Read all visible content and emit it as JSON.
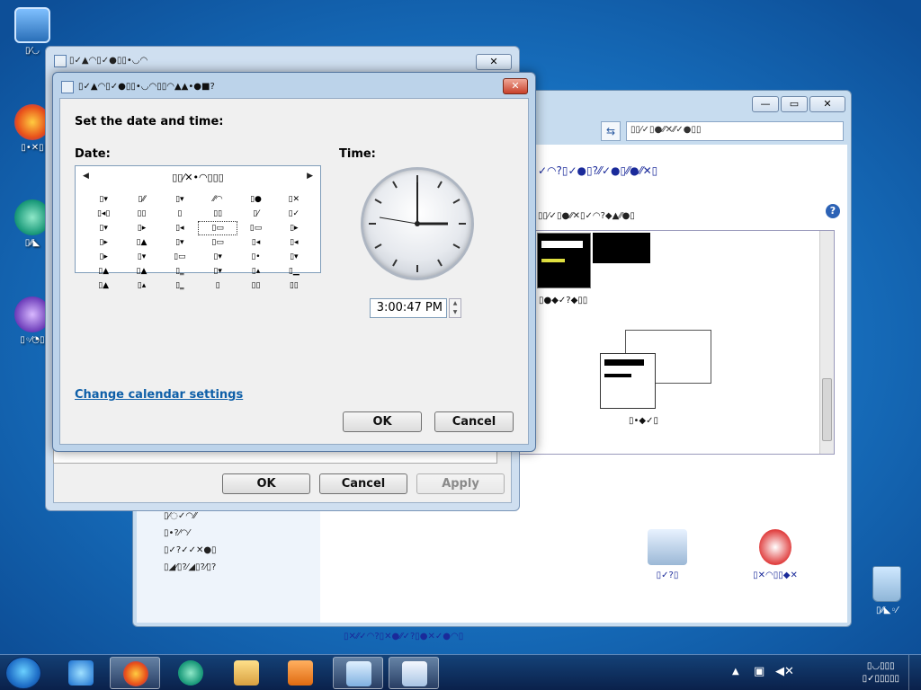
{
  "desktop": {
    "icons": [
      {
        "label": "▯⁄◡"
      },
      {
        "label": "▯•✕▯"
      },
      {
        "label": "▯⁄⁄◣"
      },
      {
        "label": "▯◦⁄◔▯"
      }
    ],
    "recycle_label": "▯⁄⁄◣◦⁄"
  },
  "back_window": {
    "search_placeholder": "▯▯⁄✓▯●⁄⁄✕⁄⁄✓●▯▯",
    "row1": "✓◠?▯✓●▯?⁄⁄✓●▯⁄⁄●⁄⁄✕▯",
    "row2": "▯▯⁄✓▯●⁄⁄✕▯✓◠?◆▲⁄⁄●▯",
    "theme1": "▯⁄◂?▯",
    "theme1b": "▯●◆✓?◆▯▯",
    "theme2": "▯⁄✓?◡",
    "theme2b": "▯•◆✓▯",
    "left_links": [
      "▯⁄◌✓◠⁄⁄",
      "▯•?⁄◠⁄",
      "▯✓?✓✓✕●▯",
      "▯◢⁄▯?⁄◢▯?⁄▯?"
    ],
    "bottom_sound": "▯✓?▯",
    "bottom_screensaver": "▯✕◠▯▯◆✕",
    "footer": "▯✕⁄⁄✓◠?▯✕●⁄⁄✓?▯●✕✓●◠▯"
  },
  "date_time_window": {
    "title": "▯✓▲◠▯✓●▯▯•◡◠",
    "ok_label": "OK",
    "cancel_label": "Cancel",
    "apply_label": "Apply"
  },
  "dialog": {
    "title": "▯✓▲◠▯✓●▯▯•◡◠▯▯◠▲▲•●■?",
    "heading": "Set the date and time:",
    "date_label": "Date:",
    "time_label": "Time:",
    "calendar_month": "▯▯⁄✕•◠▯▯▯",
    "calendar_days": [
      "▯▾",
      "▯⁄⁄",
      "▯▾",
      "⁄⁄◠",
      "▯●",
      "▯✕",
      "▯◂▯",
      "▯▯",
      "▯",
      "▯▯",
      "▯⁄",
      "▯✓",
      "▯▾",
      "▯▸",
      "▯◂",
      "▯▭",
      "▯▭",
      "▯▸",
      "▯▸",
      "▯▲",
      "▯▾",
      "▯▭",
      "▯◂",
      "▯◂",
      "▯▸",
      "▯▾",
      "▯▭",
      "▯▾",
      "▯•",
      "▯▾",
      "▯▲",
      "▯▲",
      "▯‗",
      "▯▾",
      "▯▴",
      "▯▁",
      "▯▲",
      "▯▴",
      "▯‗",
      "▯",
      "▯▯",
      "▯▯"
    ],
    "time_value": "3:00:47 PM",
    "calendar_link": "Change calendar settings",
    "ok_label": "OK",
    "cancel_label": "Cancel",
    "colors": {
      "link": "#0e5fa8",
      "accent": "#1a2a9a"
    }
  },
  "taskbar": {
    "clock_time": "▯◡▯▯▯",
    "clock_date": "▯✓▯▯▯▯▯",
    "items": [
      "ie-icon",
      "firefox-icon",
      "app-icon",
      "explorer-icon",
      "media-icon",
      "control-panel-icon",
      "clock-app-icon"
    ]
  }
}
